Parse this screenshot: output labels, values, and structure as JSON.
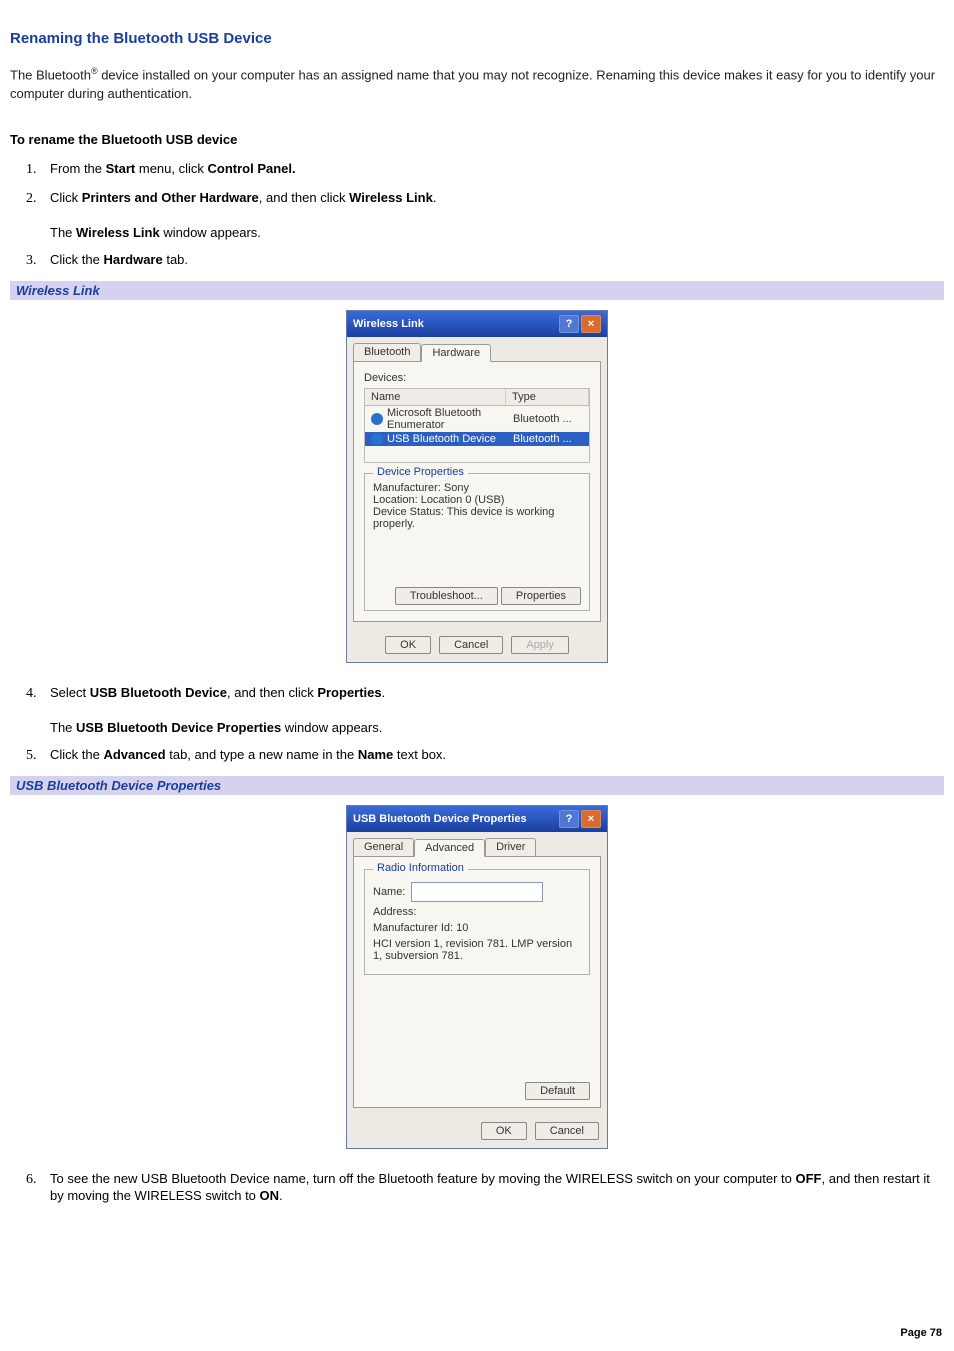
{
  "page": {
    "title": "Renaming the Bluetooth USB Device",
    "intro_a": "The Bluetooth",
    "intro_reg": "®",
    "intro_b": " device installed on your computer has an assigned name that you may not recognize. Renaming this device makes it easy for you to identify your computer during authentication.",
    "section_heading": "To rename the Bluetooth USB device",
    "page_number": "Page 78"
  },
  "steps": {
    "s1_a": "From the ",
    "s1_b1": "Start",
    "s1_c": " menu, click ",
    "s1_b2": "Control Panel.",
    "s2_a": "Click ",
    "s2_b1": "Printers and Other Hardware",
    "s2_c": ", and then click ",
    "s2_b2": "Wireless Link",
    "s2_d": ".",
    "s2_p_a": "The ",
    "s2_p_b": "Wireless Link",
    "s2_p_c": " window appears.",
    "s3_a": "Click the ",
    "s3_b": "Hardware",
    "s3_c": " tab.",
    "s4_a": "Select ",
    "s4_b1": "USB Bluetooth Device",
    "s4_c": ", and then click ",
    "s4_b2": "Properties",
    "s4_d": ".",
    "s4_p_a": "The ",
    "s4_p_b": "USB Bluetooth Device Properties",
    "s4_p_c": " window appears.",
    "s5_a": "Click the ",
    "s5_b1": "Advanced",
    "s5_c": " tab, and type a new name in the ",
    "s5_b2": "Name",
    "s5_d": " text box.",
    "s6_a": "To see the new USB Bluetooth Device name, turn off the Bluetooth feature by moving the WIRELESS switch on your computer to ",
    "s6_b1": "OFF",
    "s6_c": ", and then restart it by moving the WIRELESS switch to ",
    "s6_b2": "ON",
    "s6_d": "."
  },
  "captions": {
    "fig1": "Wireless Link",
    "fig2": "USB Bluetooth Device Properties"
  },
  "dialog1": {
    "title": "Wireless Link",
    "tabs": {
      "bluetooth": "Bluetooth",
      "hardware": "Hardware"
    },
    "devices_label": "Devices:",
    "col_name": "Name",
    "col_type": "Type",
    "rows": [
      {
        "name": "Microsoft Bluetooth Enumerator",
        "type": "Bluetooth ..."
      },
      {
        "name": "USB Bluetooth Device",
        "type": "Bluetooth ..."
      }
    ],
    "group_legend": "Device Properties",
    "manufacturer": "Manufacturer: Sony",
    "location": "Location: Location 0 (USB)",
    "status": "Device Status: This device is working properly.",
    "btn_troubleshoot": "Troubleshoot...",
    "btn_properties": "Properties",
    "btn_ok": "OK",
    "btn_cancel": "Cancel",
    "btn_apply": "Apply"
  },
  "dialog2": {
    "title": "USB Bluetooth Device Properties",
    "tabs": {
      "general": "General",
      "advanced": "Advanced",
      "driver": "Driver"
    },
    "group_legend": "Radio Information",
    "name_label": "Name:",
    "address_label": "Address:",
    "manufacturer": "Manufacturer Id:    10",
    "version": "HCI version 1, revision 781.  LMP version 1, subversion 781.",
    "btn_default": "Default",
    "btn_ok": "OK",
    "btn_cancel": "Cancel"
  }
}
